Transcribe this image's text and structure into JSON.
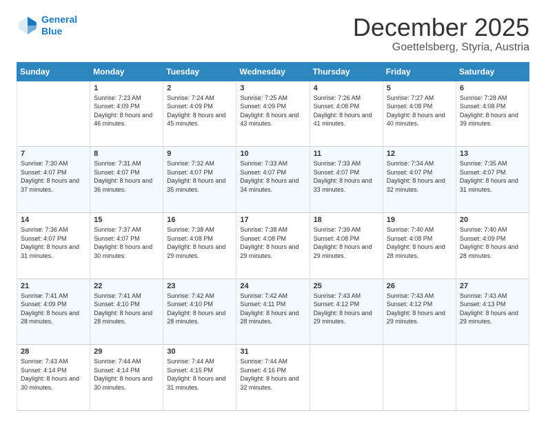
{
  "logo": {
    "line1": "General",
    "line2": "Blue"
  },
  "header": {
    "month": "December 2025",
    "location": "Goettelsberg, Styria, Austria"
  },
  "weekdays": [
    "Sunday",
    "Monday",
    "Tuesday",
    "Wednesday",
    "Thursday",
    "Friday",
    "Saturday"
  ],
  "weeks": [
    [
      {
        "day": "",
        "sunrise": "",
        "sunset": "",
        "daylight": ""
      },
      {
        "day": "1",
        "sunrise": "Sunrise: 7:23 AM",
        "sunset": "Sunset: 4:09 PM",
        "daylight": "Daylight: 8 hours and 46 minutes."
      },
      {
        "day": "2",
        "sunrise": "Sunrise: 7:24 AM",
        "sunset": "Sunset: 4:09 PM",
        "daylight": "Daylight: 8 hours and 45 minutes."
      },
      {
        "day": "3",
        "sunrise": "Sunrise: 7:25 AM",
        "sunset": "Sunset: 4:09 PM",
        "daylight": "Daylight: 8 hours and 43 minutes."
      },
      {
        "day": "4",
        "sunrise": "Sunrise: 7:26 AM",
        "sunset": "Sunset: 4:08 PM",
        "daylight": "Daylight: 8 hours and 41 minutes."
      },
      {
        "day": "5",
        "sunrise": "Sunrise: 7:27 AM",
        "sunset": "Sunset: 4:08 PM",
        "daylight": "Daylight: 8 hours and 40 minutes."
      },
      {
        "day": "6",
        "sunrise": "Sunrise: 7:28 AM",
        "sunset": "Sunset: 4:08 PM",
        "daylight": "Daylight: 8 hours and 39 minutes."
      }
    ],
    [
      {
        "day": "7",
        "sunrise": "Sunrise: 7:30 AM",
        "sunset": "Sunset: 4:07 PM",
        "daylight": "Daylight: 8 hours and 37 minutes."
      },
      {
        "day": "8",
        "sunrise": "Sunrise: 7:31 AM",
        "sunset": "Sunset: 4:07 PM",
        "daylight": "Daylight: 8 hours and 36 minutes."
      },
      {
        "day": "9",
        "sunrise": "Sunrise: 7:32 AM",
        "sunset": "Sunset: 4:07 PM",
        "daylight": "Daylight: 8 hours and 35 minutes."
      },
      {
        "day": "10",
        "sunrise": "Sunrise: 7:33 AM",
        "sunset": "Sunset: 4:07 PM",
        "daylight": "Daylight: 8 hours and 34 minutes."
      },
      {
        "day": "11",
        "sunrise": "Sunrise: 7:33 AM",
        "sunset": "Sunset: 4:07 PM",
        "daylight": "Daylight: 8 hours and 33 minutes."
      },
      {
        "day": "12",
        "sunrise": "Sunrise: 7:34 AM",
        "sunset": "Sunset: 4:07 PM",
        "daylight": "Daylight: 8 hours and 32 minutes."
      },
      {
        "day": "13",
        "sunrise": "Sunrise: 7:35 AM",
        "sunset": "Sunset: 4:07 PM",
        "daylight": "Daylight: 8 hours and 31 minutes."
      }
    ],
    [
      {
        "day": "14",
        "sunrise": "Sunrise: 7:36 AM",
        "sunset": "Sunset: 4:07 PM",
        "daylight": "Daylight: 8 hours and 31 minutes."
      },
      {
        "day": "15",
        "sunrise": "Sunrise: 7:37 AM",
        "sunset": "Sunset: 4:07 PM",
        "daylight": "Daylight: 8 hours and 30 minutes."
      },
      {
        "day": "16",
        "sunrise": "Sunrise: 7:38 AM",
        "sunset": "Sunset: 4:08 PM",
        "daylight": "Daylight: 8 hours and 29 minutes."
      },
      {
        "day": "17",
        "sunrise": "Sunrise: 7:38 AM",
        "sunset": "Sunset: 4:08 PM",
        "daylight": "Daylight: 8 hours and 29 minutes."
      },
      {
        "day": "18",
        "sunrise": "Sunrise: 7:39 AM",
        "sunset": "Sunset: 4:08 PM",
        "daylight": "Daylight: 8 hours and 29 minutes."
      },
      {
        "day": "19",
        "sunrise": "Sunrise: 7:40 AM",
        "sunset": "Sunset: 4:08 PM",
        "daylight": "Daylight: 8 hours and 28 minutes."
      },
      {
        "day": "20",
        "sunrise": "Sunrise: 7:40 AM",
        "sunset": "Sunset: 4:09 PM",
        "daylight": "Daylight: 8 hours and 28 minutes."
      }
    ],
    [
      {
        "day": "21",
        "sunrise": "Sunrise: 7:41 AM",
        "sunset": "Sunset: 4:09 PM",
        "daylight": "Daylight: 8 hours and 28 minutes."
      },
      {
        "day": "22",
        "sunrise": "Sunrise: 7:41 AM",
        "sunset": "Sunset: 4:10 PM",
        "daylight": "Daylight: 8 hours and 28 minutes."
      },
      {
        "day": "23",
        "sunrise": "Sunrise: 7:42 AM",
        "sunset": "Sunset: 4:10 PM",
        "daylight": "Daylight: 8 hours and 28 minutes."
      },
      {
        "day": "24",
        "sunrise": "Sunrise: 7:42 AM",
        "sunset": "Sunset: 4:11 PM",
        "daylight": "Daylight: 8 hours and 28 minutes."
      },
      {
        "day": "25",
        "sunrise": "Sunrise: 7:43 AM",
        "sunset": "Sunset: 4:12 PM",
        "daylight": "Daylight: 8 hours and 29 minutes."
      },
      {
        "day": "26",
        "sunrise": "Sunrise: 7:43 AM",
        "sunset": "Sunset: 4:12 PM",
        "daylight": "Daylight: 8 hours and 29 minutes."
      },
      {
        "day": "27",
        "sunrise": "Sunrise: 7:43 AM",
        "sunset": "Sunset: 4:13 PM",
        "daylight": "Daylight: 8 hours and 29 minutes."
      }
    ],
    [
      {
        "day": "28",
        "sunrise": "Sunrise: 7:43 AM",
        "sunset": "Sunset: 4:14 PM",
        "daylight": "Daylight: 8 hours and 30 minutes."
      },
      {
        "day": "29",
        "sunrise": "Sunrise: 7:44 AM",
        "sunset": "Sunset: 4:14 PM",
        "daylight": "Daylight: 8 hours and 30 minutes."
      },
      {
        "day": "30",
        "sunrise": "Sunrise: 7:44 AM",
        "sunset": "Sunset: 4:15 PM",
        "daylight": "Daylight: 8 hours and 31 minutes."
      },
      {
        "day": "31",
        "sunrise": "Sunrise: 7:44 AM",
        "sunset": "Sunset: 4:16 PM",
        "daylight": "Daylight: 8 hours and 32 minutes."
      },
      {
        "day": "",
        "sunrise": "",
        "sunset": "",
        "daylight": ""
      },
      {
        "day": "",
        "sunrise": "",
        "sunset": "",
        "daylight": ""
      },
      {
        "day": "",
        "sunrise": "",
        "sunset": "",
        "daylight": ""
      }
    ]
  ]
}
